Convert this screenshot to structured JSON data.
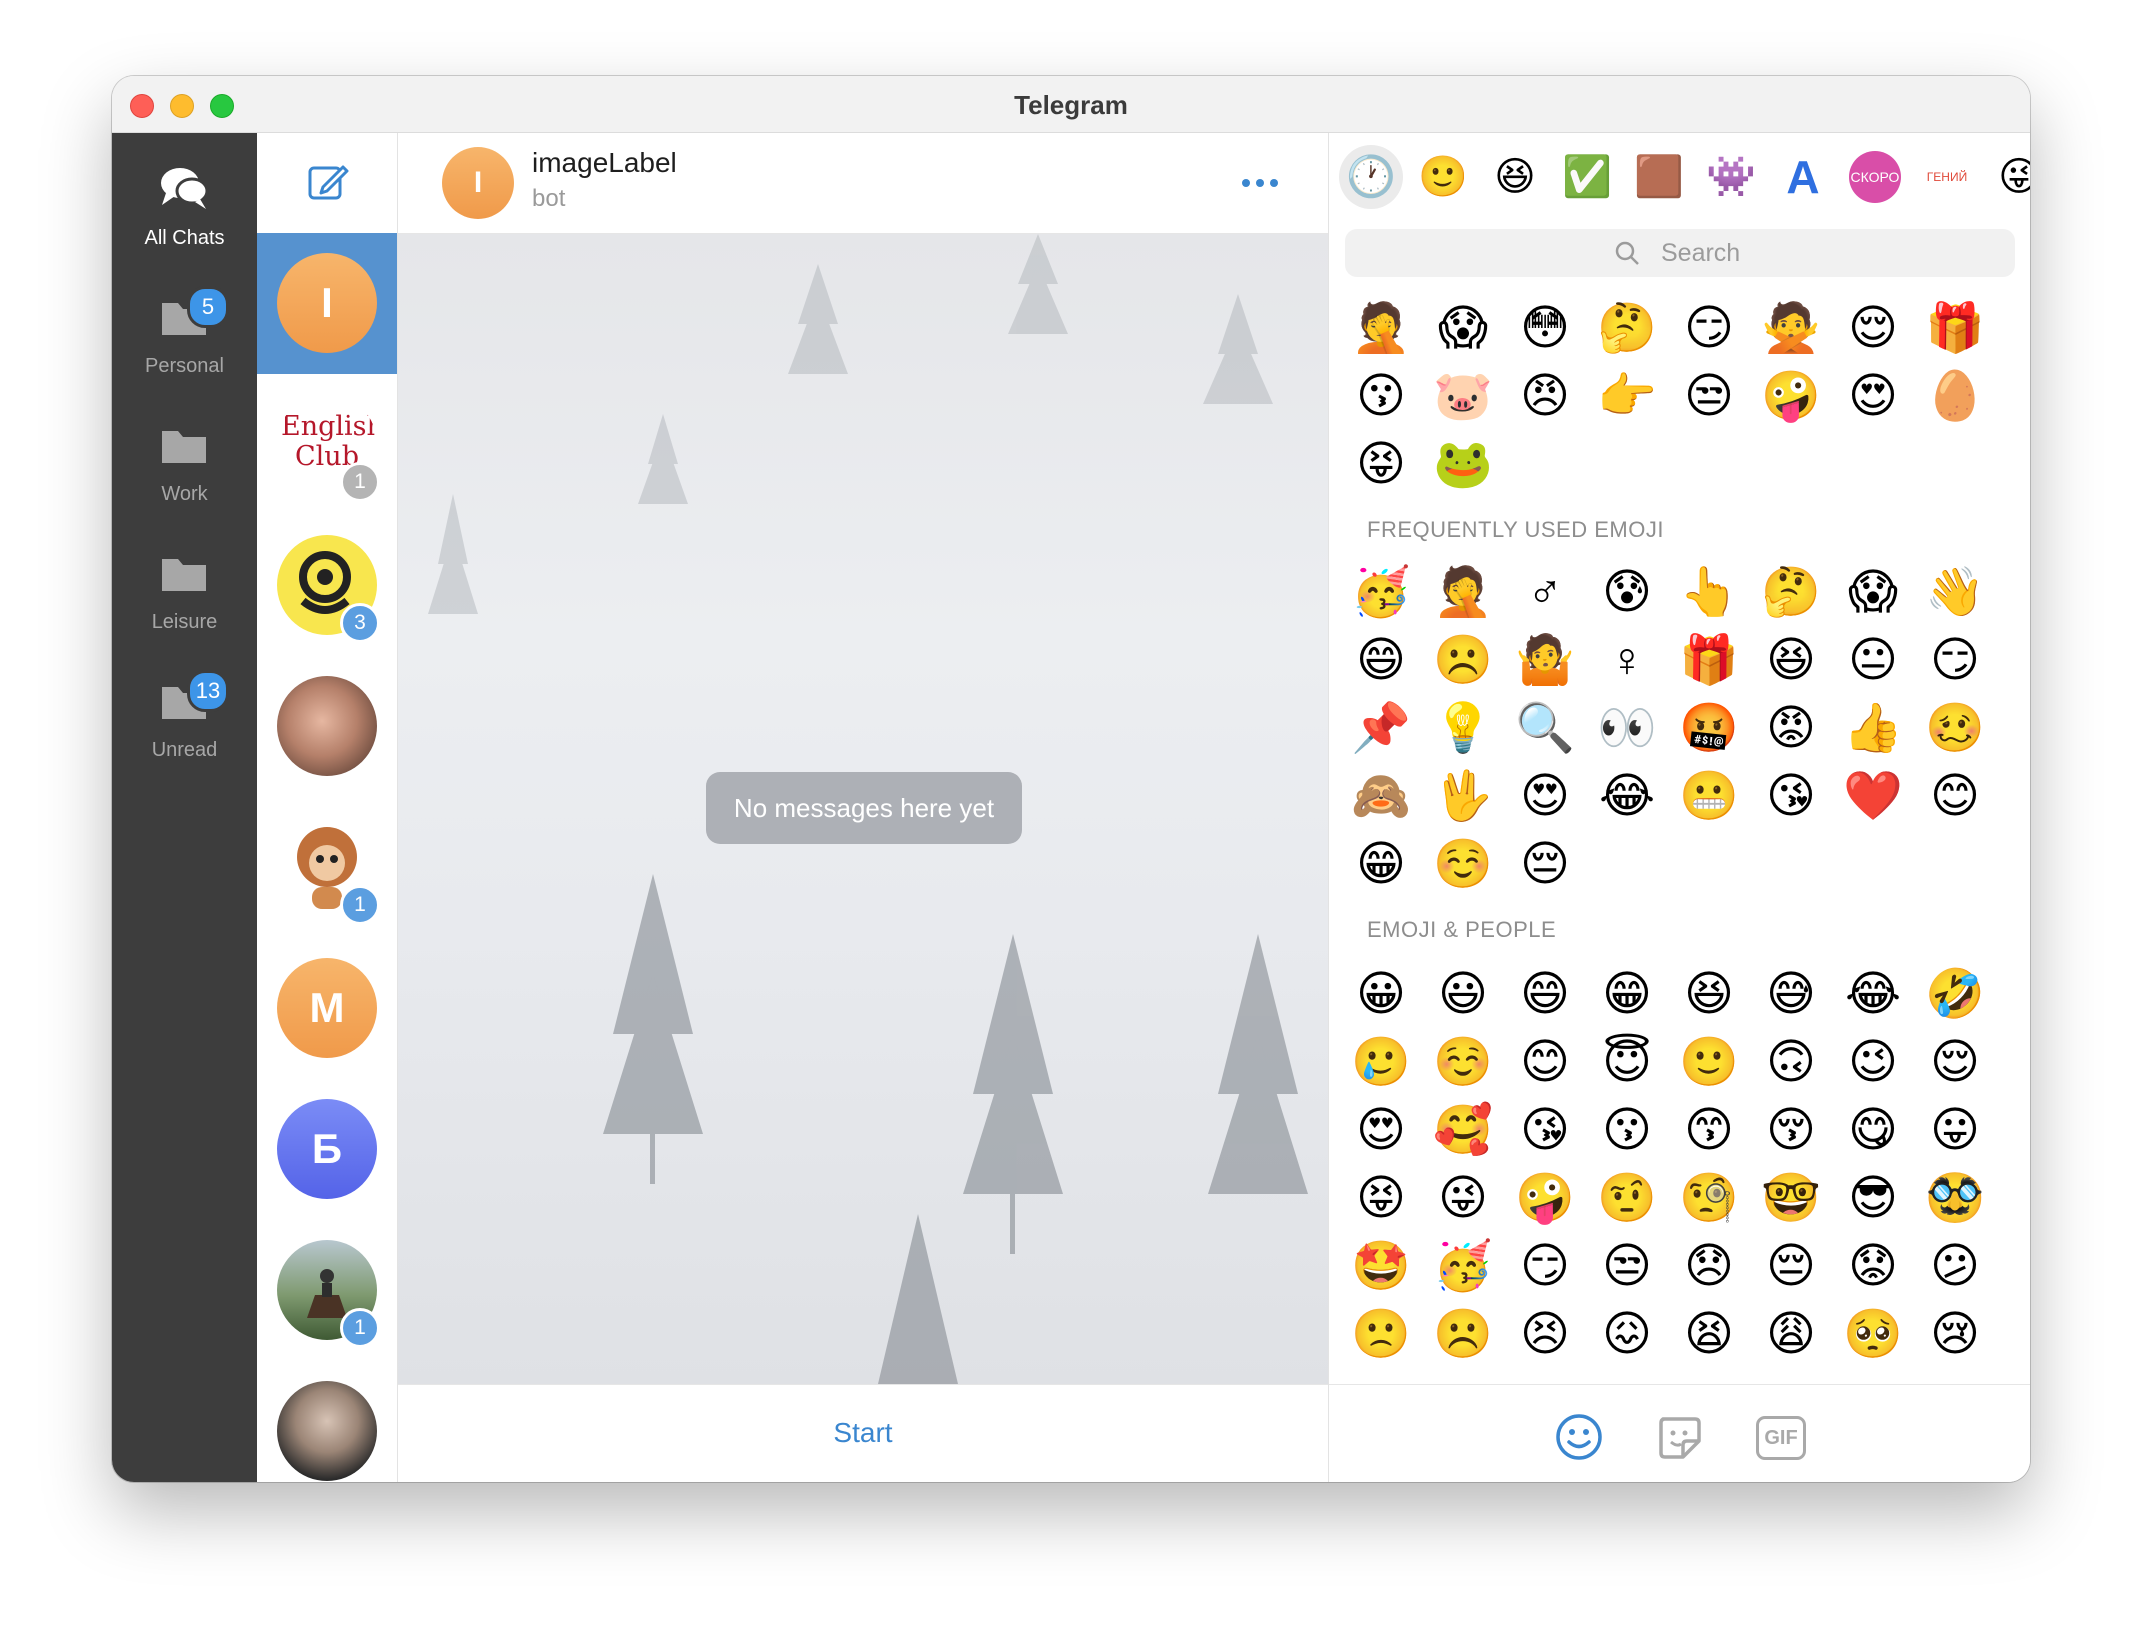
{
  "window": {
    "title": "Telegram"
  },
  "folders": [
    {
      "label": "All Chats",
      "badge": "",
      "icon": "chat-bubbles-icon",
      "active": true
    },
    {
      "label": "Personal",
      "badge": "5",
      "icon": "folder-icon"
    },
    {
      "label": "Work",
      "badge": "",
      "icon": "folder-icon"
    },
    {
      "label": "Leisure",
      "badge": "",
      "icon": "folder-icon"
    },
    {
      "label": "Unread",
      "badge": "13",
      "icon": "folder-icon"
    }
  ],
  "chats": [
    {
      "initial": "I",
      "badge": "",
      "selected": true
    },
    {
      "logo_text": "English Club",
      "badge": "1",
      "badge_style": "muted"
    },
    {
      "initial": "",
      "badge": "3"
    },
    {
      "initial": "",
      "badge": ""
    },
    {
      "initial": "",
      "badge": "1"
    },
    {
      "initial": "M",
      "badge": ""
    },
    {
      "initial": "Б",
      "badge": ""
    },
    {
      "initial": "",
      "badge": "1"
    },
    {
      "initial": "",
      "badge": ""
    }
  ],
  "conversation": {
    "avatar_initial": "I",
    "name": "imageLabel",
    "subtitle": "bot",
    "empty_text": "No messages here yet",
    "start_label": "Start"
  },
  "emoji_panel": {
    "search_placeholder": "Search",
    "tabs": [
      "🕐",
      "🙂",
      "😆",
      "✅",
      "🟫",
      "👾",
      "A",
      "СКОРО",
      "ГЕНИЙ",
      "😜"
    ],
    "recent_stickers": [
      "🤦",
      "😱",
      "😳",
      "🤔",
      "😏",
      "🙅",
      "😌",
      "🎁",
      "😗",
      "🐷",
      "😠",
      "👉",
      "😒",
      "🤪",
      "😍",
      "🥚",
      "😝",
      "🐸"
    ],
    "frequently_used_title": "FREQUENTLY USED EMOJI",
    "frequently_used": [
      "🥳",
      "🤦",
      "♂",
      "😰",
      "👆",
      "🤔",
      "😱",
      "👋",
      "😄",
      "☹️",
      "🤷",
      "♀",
      "🎁",
      "😆",
      "😐",
      "😏",
      "📌",
      "💡",
      "🔍",
      "👀",
      "🤬",
      "😡",
      "👍",
      "🥴",
      "🙈",
      "🖖",
      "😍",
      "😂",
      "😬",
      "😘",
      "❤️",
      "😊",
      "😁",
      "☺️",
      "😔"
    ],
    "people_title": "EMOJI & PEOPLE",
    "people": [
      "😀",
      "😃",
      "😄",
      "😁",
      "😆",
      "😅",
      "😂",
      "🤣",
      "🥲",
      "☺️",
      "😊",
      "😇",
      "🙂",
      "🙃",
      "😉",
      "😌",
      "😍",
      "🥰",
      "😘",
      "😗",
      "😙",
      "😚",
      "😋",
      "😛",
      "😝",
      "😜",
      "🤪",
      "🤨",
      "🧐",
      "🤓",
      "😎",
      "🥸",
      "🤩",
      "🥳",
      "😏",
      "😒",
      "😞",
      "😔",
      "😟",
      "😕",
      "🙁",
      "☹️",
      "😣",
      "😖",
      "😫",
      "😩",
      "🥺",
      "😢"
    ],
    "footer_tabs": [
      "emoji-tab-icon",
      "sticker-tab-icon",
      "GIF"
    ]
  },
  "colors": {
    "accent": "#3a86cf",
    "sidebar": "#3d3d3d",
    "selected_chat": "#5692cf",
    "badge": "#3d95e8"
  }
}
